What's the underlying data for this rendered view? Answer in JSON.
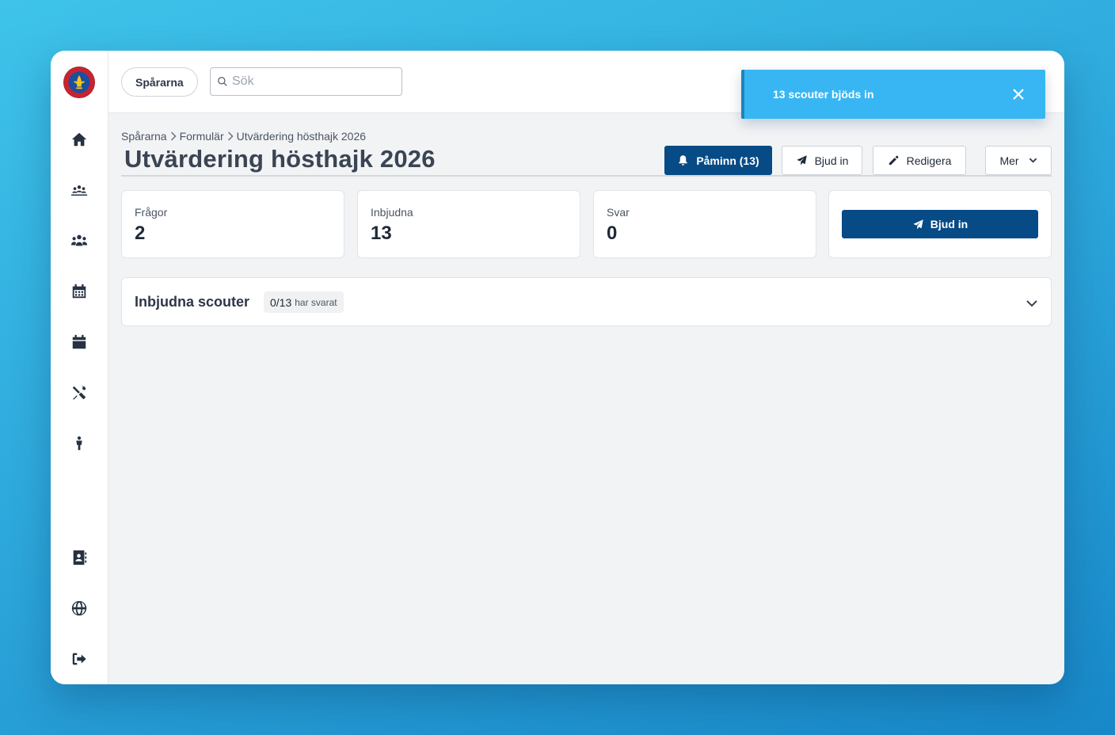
{
  "topbar": {
    "org_label": "Spårarna",
    "search_placeholder": "Sök"
  },
  "toast": {
    "message": "13 scouter bjöds in",
    "color": "#38b6f3"
  },
  "sidebar": {
    "items": [
      {
        "icon": "home-icon"
      },
      {
        "icon": "group-icon"
      },
      {
        "icon": "users-icon"
      },
      {
        "icon": "calendar-days-icon"
      },
      {
        "icon": "calendar-icon"
      },
      {
        "icon": "tools-icon"
      },
      {
        "icon": "child-icon"
      },
      {
        "icon": "address-book-icon"
      },
      {
        "icon": "globe-icon"
      },
      {
        "icon": "logout-icon"
      }
    ]
  },
  "breadcrumb": {
    "items": [
      "Spårarna",
      "Formulär",
      "Utvärdering hösthajk 2026"
    ]
  },
  "page": {
    "title": "Utvärdering hösthajk 2026"
  },
  "actions": {
    "remind_label": "Påminn (13)",
    "invite_label": "Bjud in",
    "edit_label": "Redigera",
    "more_label": "Mer"
  },
  "stats": [
    {
      "label": "Frågor",
      "value": "2"
    },
    {
      "label": "Inbjudna",
      "value": "13"
    },
    {
      "label": "Svar",
      "value": "0"
    }
  ],
  "invite_card": {
    "button_label": "Bjud in"
  },
  "invited_panel": {
    "title": "Inbjudna scouter",
    "count": "0/13",
    "suffix": "har svarat"
  },
  "colors": {
    "primary": "#064b86",
    "toast": "#38b6f3",
    "background_gradient": [
      "#3ec3ea",
      "#1888c8"
    ]
  }
}
